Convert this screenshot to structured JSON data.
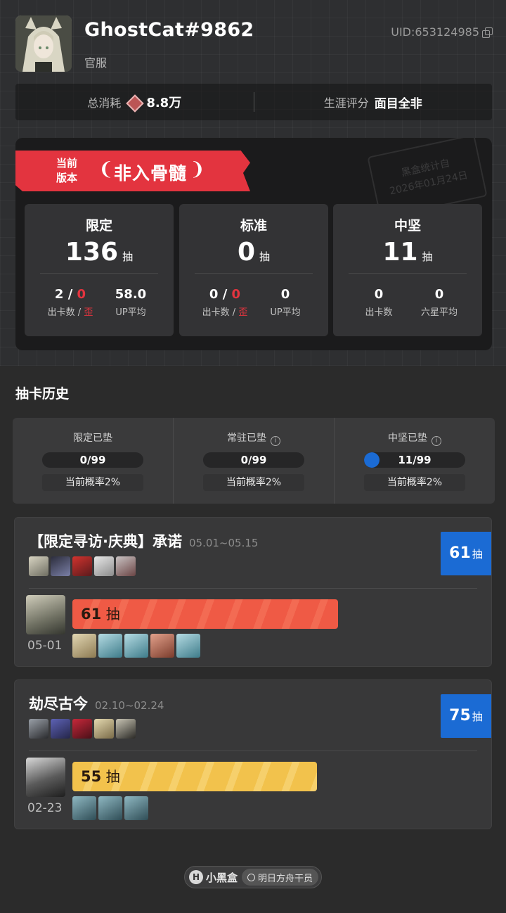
{
  "profile": {
    "username": "GhostCat#9862",
    "server": "官服",
    "uid": "UID:653124985"
  },
  "stats": {
    "spend_label": "总消耗",
    "spend_value": "8.8万",
    "rating_label": "生涯评分",
    "rating_value": "面目全非"
  },
  "version": {
    "ribbon_line1": "当前",
    "ribbon_line2": "版本",
    "ribbon_title": "非入骨髓",
    "stamp_line1": "黑盒统计自",
    "stamp_line2": "2026年01月24日",
    "pools": [
      {
        "name": "限定",
        "count": "136",
        "unit": "抽",
        "s1_a": "2",
        "s1_sep": " / ",
        "s1_b": "0",
        "s1_label_a": "出卡数 / ",
        "s1_label_b": "歪",
        "s2": "58.0",
        "s2_label": "UP平均"
      },
      {
        "name": "标准",
        "count": "0",
        "unit": "抽",
        "s1_a": "0",
        "s1_sep": " / ",
        "s1_b": "0",
        "s1_label_a": "出卡数 / ",
        "s1_label_b": "歪",
        "s2": "0",
        "s2_label": "UP平均"
      },
      {
        "name": "中坚",
        "count": "11",
        "unit": "抽",
        "s1_a": "0",
        "s1_label_a": "出卡数",
        "s2": "0",
        "s2_label": "六星平均"
      }
    ]
  },
  "history": {
    "title": "抽卡历史",
    "pity": [
      {
        "label": "限定已垫",
        "value": "0/99",
        "progress": 0.0,
        "rate": "当前概率2%"
      },
      {
        "label": "常驻已垫",
        "value": "0/99",
        "progress": 0.0,
        "rate": "当前概率2%"
      },
      {
        "label": "中坚已垫",
        "value": "11/99",
        "progress": 0.111,
        "rate": "当前概率2%"
      }
    ],
    "banners": [
      {
        "title": "【限定寻访·庆典】承诺",
        "date": "05.01~05.15",
        "total": "61",
        "total_unit": "抽",
        "pull_count": "61",
        "pull_unit": "抽",
        "pull_date": "05-01"
      },
      {
        "title": "劫尽古今",
        "date": "02.10~02.24",
        "total": "75",
        "total_unit": "抽",
        "pull_count": "55",
        "pull_unit": "抽",
        "pull_date": "02-23"
      }
    ]
  },
  "footer": {
    "brand": "小黑盒",
    "search": "明日方舟干员"
  },
  "colors": {
    "accent_red": "#e3343f",
    "accent_blue": "#1b6bd4",
    "bar_red": "#ef5a45",
    "bar_yellow": "#f2c24c"
  }
}
